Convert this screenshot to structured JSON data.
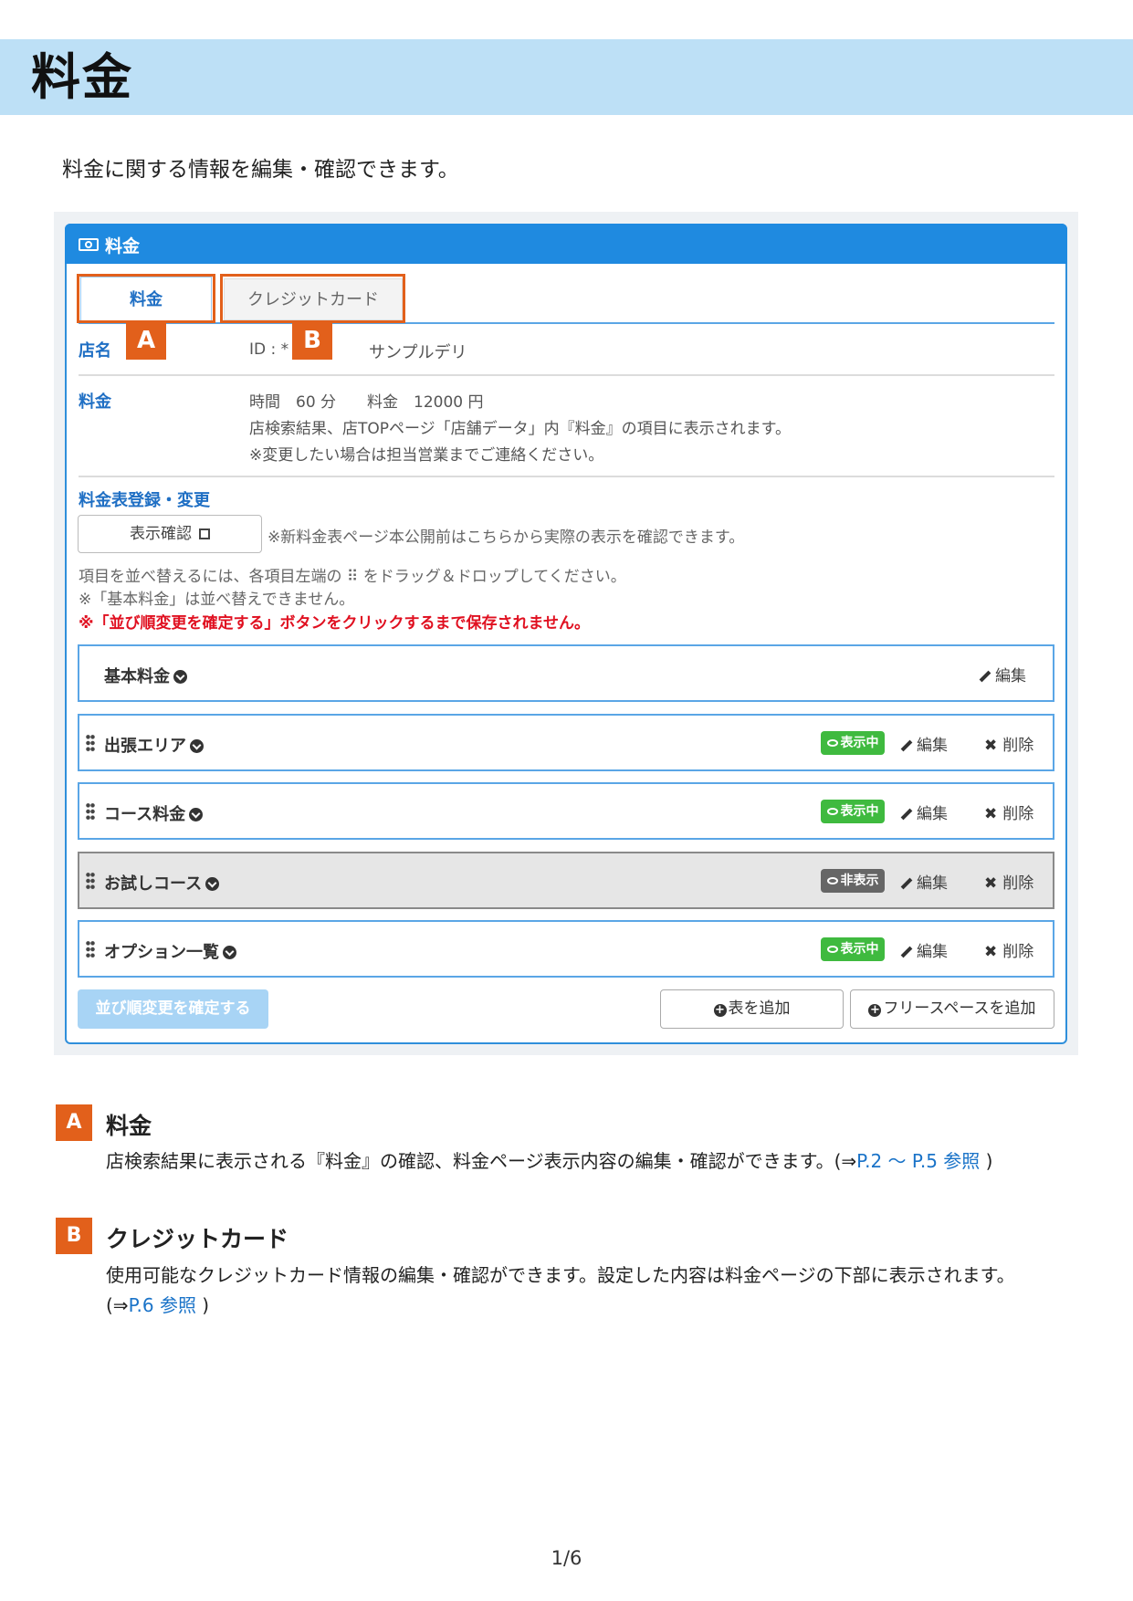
{
  "page": {
    "title": "料金",
    "intro": "料金に関する情報を編集・確認できます。",
    "page_number": "1/6"
  },
  "panel": {
    "title": "料金",
    "tabs": [
      {
        "label": "料金",
        "badge": "A"
      },
      {
        "label": "クレジットカード",
        "badge": "B"
      }
    ],
    "store": {
      "label": "店名",
      "id_prefix": "ID : *",
      "name": "サンプルデリ"
    },
    "fee": {
      "label": "料金",
      "line1": "時間　60 分　　料金　12000 円",
      "line2": "店検索結果、店TOPページ「店舗データ」内『料金』の項目に表示されます。",
      "line3": "※変更したい場合は担当営業までご連絡ください。"
    },
    "table_section": {
      "label": "料金表登録・変更",
      "show_button": "表示確認",
      "show_note": "※新料金表ページ本公開前はこちらから実際の表示を確認できます。",
      "note1": "項目を並べ替えるには、各項目左端の ⠿ をドラッグ＆ドロップしてください。",
      "note2": "※「基本料金」は並べ替えできません。",
      "warning": "※「並び順変更を確定する」ボタンをクリックするまで保存されません。"
    },
    "items": [
      {
        "name": "基本料金",
        "status": null,
        "edit": "編集",
        "delete": null
      },
      {
        "name": "出張エリア",
        "status": "表示中",
        "edit": "編集",
        "delete": "削除"
      },
      {
        "name": "コース料金",
        "status": "表示中",
        "edit": "編集",
        "delete": "削除"
      },
      {
        "name": "お試しコース",
        "status": "非表示",
        "edit": "編集",
        "delete": "削除"
      },
      {
        "name": "オプション一覧",
        "status": "表示中",
        "edit": "編集",
        "delete": "削除"
      }
    ],
    "buttons": {
      "confirm_order": "並び順変更を確定する",
      "add_table": "表を追加",
      "add_free_space": "フリースペースを追加"
    }
  },
  "explanations": [
    {
      "badge": "A",
      "title": "料金",
      "text": "店検索結果に表示される『料金』の確認、料金ページ表示内容の編集・確認ができます。(⇒",
      "link": "P.2 〜 P.5 参照",
      "suffix": " )"
    },
    {
      "badge": "B",
      "title": "クレジットカード",
      "text": "使用可能なクレジットカード情報の編集・確認ができます。設定した内容は料金ページの下部に表示されます。",
      "text2": "(⇒",
      "link": "P.6 参照",
      "suffix": " )"
    }
  ],
  "colors": {
    "accent_blue": "#1f8ae0",
    "badge_orange": "#e2601b",
    "status_on": "#3fba3f",
    "warning_red": "#e01020"
  }
}
